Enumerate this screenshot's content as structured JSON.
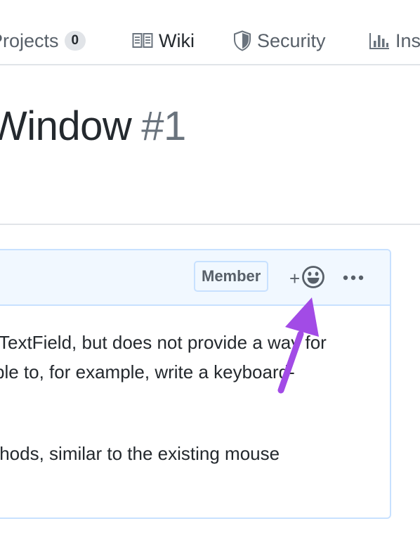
{
  "nav": {
    "projects": {
      "label": "Projects",
      "count": "0"
    },
    "wiki": {
      "label": "Wiki"
    },
    "security": {
      "label": "Security"
    },
    "insights": {
      "label": "Ins"
    }
  },
  "issue": {
    "title": "Window",
    "number": "#1"
  },
  "comment": {
    "badge": "Member",
    "reaction_plus": "+",
    "lines": [
      "TextField, but does not provide a way for",
      "ble to, for example, write a keyboard-",
      "thods, similar to the existing mouse"
    ]
  },
  "annotation": {
    "arrow_color": "#a24be6"
  },
  "icons": [
    "book-icon",
    "shield-icon",
    "graph-icon",
    "smiley-icon",
    "kebab-horizontal-icon",
    "arrow-annotation"
  ]
}
